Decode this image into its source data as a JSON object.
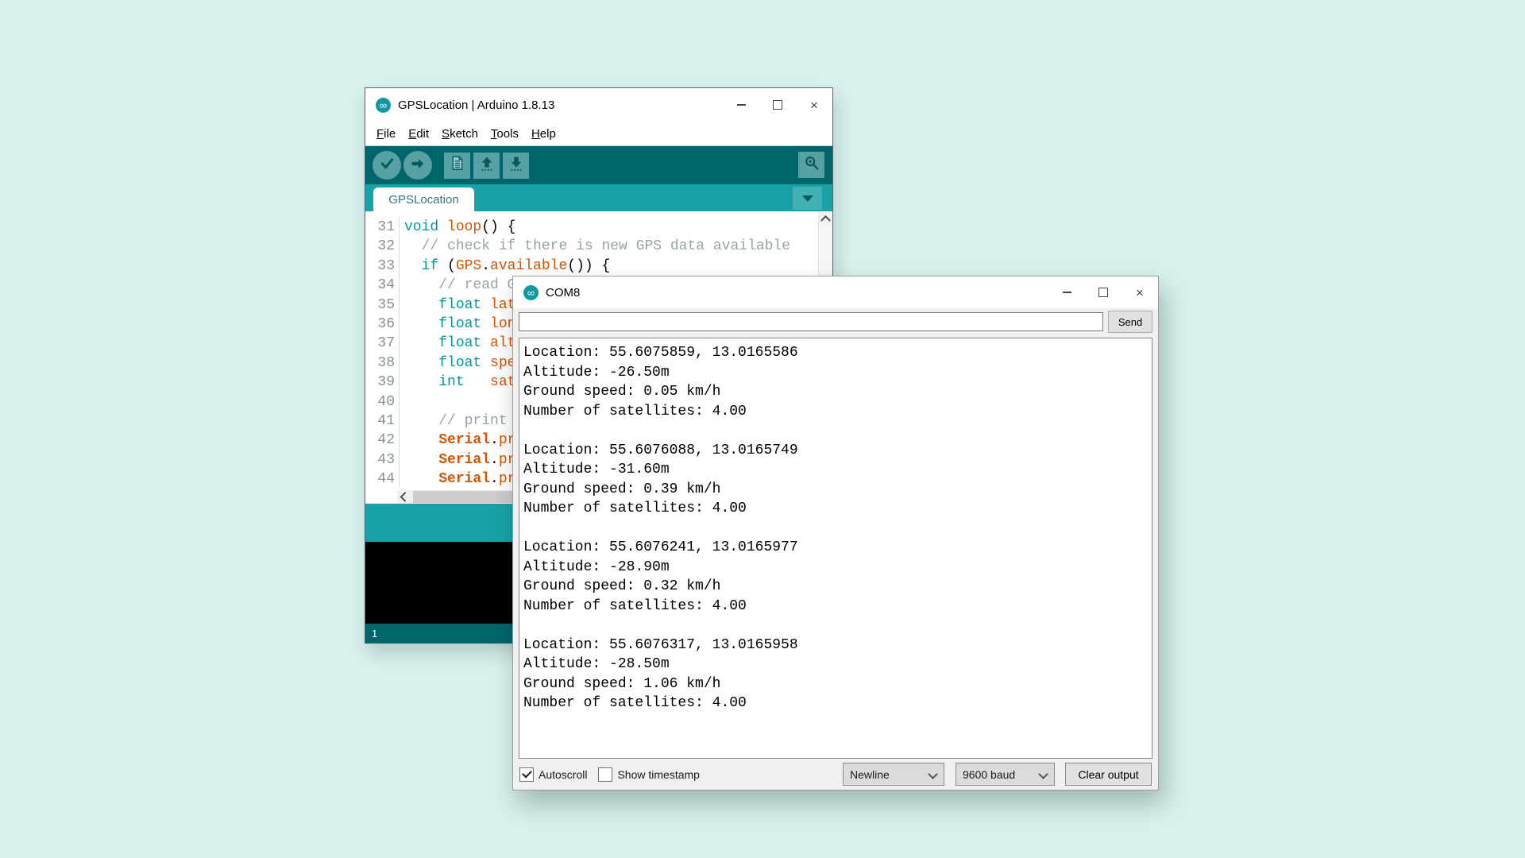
{
  "colors": {
    "desktop_background": "#d7f1ee",
    "teal_dark": "#00656b",
    "teal_bright": "#18a2a6",
    "toolbar_button": "#57a0a3",
    "keyword": "#00979c",
    "function": "#d35400",
    "comment": "#95a5a6"
  },
  "arduino": {
    "title": "GPSLocation | Arduino 1.8.13",
    "icon": "arduino-logo-icon",
    "menu_items": [
      "File",
      "Edit",
      "Sketch",
      "Tools",
      "Help"
    ],
    "toolbar_buttons": [
      {
        "name": "verify",
        "icon": "check-icon",
        "shape": "circle"
      },
      {
        "name": "upload",
        "icon": "arrow-right-icon",
        "shape": "circle"
      },
      {
        "name": "new-sketch",
        "icon": "document-icon",
        "shape": "square"
      },
      {
        "name": "open",
        "icon": "arrow-up-icon",
        "shape": "square"
      },
      {
        "name": "save",
        "icon": "arrow-down-icon",
        "shape": "square"
      }
    ],
    "serial_monitor_button": {
      "name": "serial-monitor",
      "icon": "magnifier-icon"
    },
    "tab_label": "GPSLocation",
    "editor_lines": [
      {
        "num": "31",
        "tokens": [
          [
            "void",
            "kw"
          ],
          [
            " ",
            "pl"
          ],
          [
            "loop",
            "fn"
          ],
          [
            "() {",
            "pl"
          ]
        ]
      },
      {
        "num": "32",
        "tokens": [
          [
            "  ",
            "pl"
          ],
          [
            "// check if there is new GPS data available",
            "cm"
          ]
        ]
      },
      {
        "num": "33",
        "tokens": [
          [
            "  ",
            "pl"
          ],
          [
            "if",
            "kw"
          ],
          [
            " (",
            "pl"
          ],
          [
            "GPS",
            "fn"
          ],
          [
            ".",
            "pl"
          ],
          [
            "available",
            "fn"
          ],
          [
            "()) {",
            "pl"
          ]
        ]
      },
      {
        "num": "34",
        "tokens": [
          [
            "    ",
            "pl"
          ],
          [
            "// read G",
            "cm"
          ]
        ]
      },
      {
        "num": "35",
        "tokens": [
          [
            "    ",
            "pl"
          ],
          [
            "float",
            "kw"
          ],
          [
            " ",
            "pl"
          ],
          [
            "lat",
            "fn"
          ]
        ]
      },
      {
        "num": "36",
        "tokens": [
          [
            "    ",
            "pl"
          ],
          [
            "float",
            "kw"
          ],
          [
            " ",
            "pl"
          ],
          [
            "lon",
            "fn"
          ]
        ]
      },
      {
        "num": "37",
        "tokens": [
          [
            "    ",
            "pl"
          ],
          [
            "float",
            "kw"
          ],
          [
            " ",
            "pl"
          ],
          [
            "alt",
            "fn"
          ]
        ]
      },
      {
        "num": "38",
        "tokens": [
          [
            "    ",
            "pl"
          ],
          [
            "float",
            "kw"
          ],
          [
            " ",
            "pl"
          ],
          [
            "spe",
            "fn"
          ]
        ]
      },
      {
        "num": "39",
        "tokens": [
          [
            "    ",
            "pl"
          ],
          [
            "int",
            "kw"
          ],
          [
            "   ",
            "pl"
          ],
          [
            "sat",
            "fn"
          ]
        ]
      },
      {
        "num": "40",
        "tokens": []
      },
      {
        "num": "41",
        "tokens": [
          [
            "    ",
            "pl"
          ],
          [
            "// print ",
            "cm"
          ]
        ]
      },
      {
        "num": "42",
        "tokens": [
          [
            "    ",
            "pl"
          ],
          [
            "Serial",
            "fnb"
          ],
          [
            ".",
            "pl"
          ],
          [
            "pr",
            "fn"
          ]
        ]
      },
      {
        "num": "43",
        "tokens": [
          [
            "    ",
            "pl"
          ],
          [
            "Serial",
            "fnb"
          ],
          [
            ".",
            "pl"
          ],
          [
            "pr",
            "fn"
          ]
        ]
      },
      {
        "num": "44",
        "tokens": [
          [
            "    ",
            "pl"
          ],
          [
            "Serial",
            "fnb"
          ],
          [
            ".",
            "pl"
          ],
          [
            "pr",
            "fn"
          ]
        ]
      }
    ],
    "status_left": "1"
  },
  "serial_monitor": {
    "title": "COM8",
    "icon": "arduino-logo-icon",
    "input_value": "",
    "send_label": "Send",
    "output_lines": [
      "Location: 55.6075859, 13.0165586",
      "Altitude: -26.50m",
      "Ground speed: 0.05 km/h",
      "Number of satellites: 4.00",
      "",
      "Location: 55.6076088, 13.0165749",
      "Altitude: -31.60m",
      "Ground speed: 0.39 km/h",
      "Number of satellites: 4.00",
      "",
      "Location: 55.6076241, 13.0165977",
      "Altitude: -28.90m",
      "Ground speed: 0.32 km/h",
      "Number of satellites: 4.00",
      "",
      "Location: 55.6076317, 13.0165958",
      "Altitude: -28.50m",
      "Ground speed: 1.06 km/h",
      "Number of satellites: 4.00"
    ],
    "autoscroll": {
      "label": "Autoscroll",
      "checked": true
    },
    "show_timestamp": {
      "label": "Show timestamp",
      "checked": false
    },
    "line_ending_value": "Newline",
    "baud_value": "9600 baud",
    "clear_button_label": "Clear output"
  }
}
